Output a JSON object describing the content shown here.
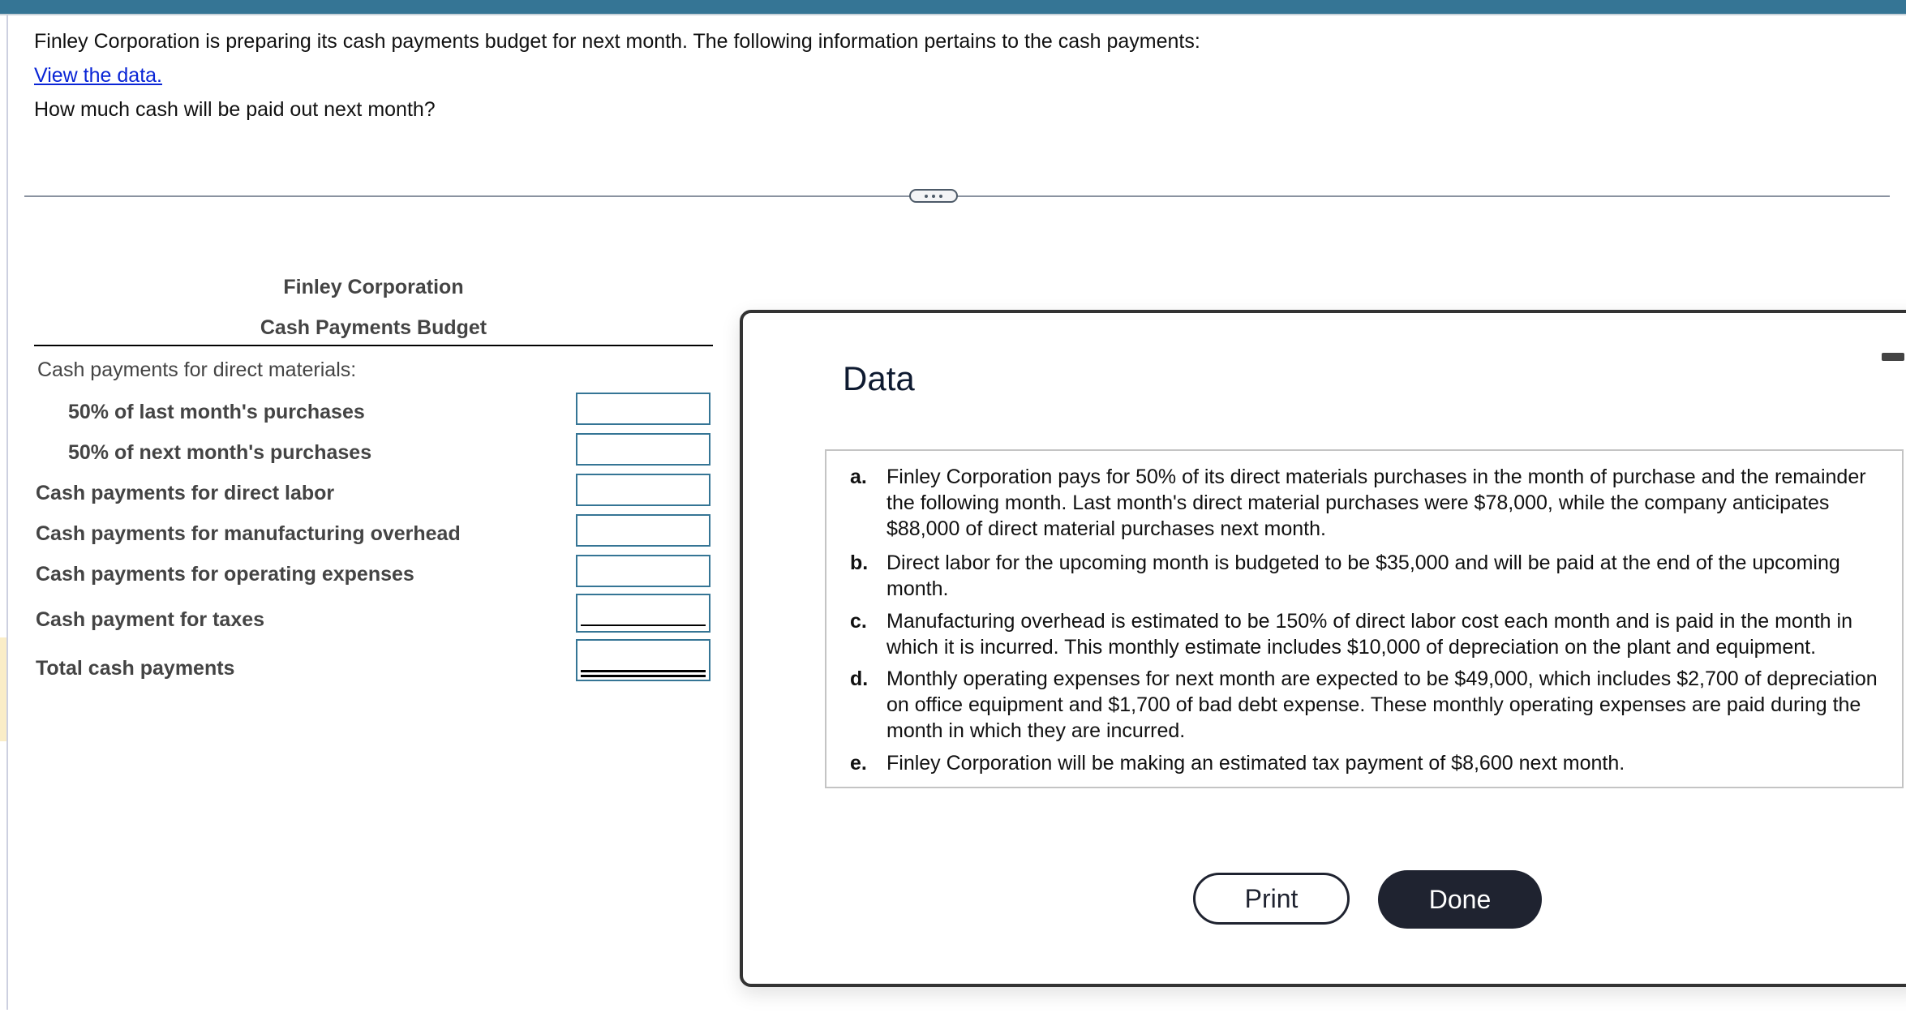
{
  "question": {
    "intro": "Finley Corporation is preparing its cash payments budget for next month. The following information pertains to the cash payments:",
    "link": "View the data.",
    "prompt": "How much cash will be paid out next month?"
  },
  "divider": {
    "icon": "more-horizontal-icon"
  },
  "budget": {
    "company": "Finley Corporation",
    "title": "Cash Payments Budget",
    "section_label": "Cash payments for direct materials:",
    "rows": [
      {
        "label": "50% of last month's purchases",
        "value": ""
      },
      {
        "label": "50% of next month's purchases",
        "value": ""
      },
      {
        "label": "Cash payments for direct labor",
        "value": ""
      },
      {
        "label": "Cash payments for manufacturing overhead",
        "value": ""
      },
      {
        "label": "Cash payments for operating expenses",
        "value": ""
      },
      {
        "label": "Cash payment for taxes",
        "value": ""
      },
      {
        "label": "Total cash payments",
        "value": ""
      }
    ]
  },
  "modal": {
    "title": "Data",
    "items": [
      {
        "letter": "a.",
        "text": "Finley Corporation pays for 50% of its direct materials purchases in the month of purchase and the remainder the following month. Last month's direct material purchases were $78,000, while the company anticipates $88,000 of direct material purchases next month."
      },
      {
        "letter": "b.",
        "text": "Direct labor for the upcoming month is budgeted to be $35,000 and will be paid at the end of the upcoming month."
      },
      {
        "letter": "c.",
        "text": "Manufacturing overhead is estimated to be 150% of direct labor cost each month and is paid in the month in which it is incurred. This monthly estimate includes $10,000 of depreciation on the plant and equipment."
      },
      {
        "letter": "d.",
        "text": "Monthly operating expenses for next month are expected to be $49,000, which includes $2,700 of depreciation on office equipment and $1,700 of bad debt expense. These monthly operating expenses are paid during the month in which they are incurred."
      },
      {
        "letter": "e.",
        "text": "Finley Corporation will be making an estimated tax payment of $8,600 next month."
      }
    ],
    "print_label": "Print",
    "done_label": "Done"
  },
  "colors": {
    "header_bar": "#357595",
    "input_border": "#357595",
    "link": "#0a25d6",
    "button_dark": "#1f2330"
  }
}
